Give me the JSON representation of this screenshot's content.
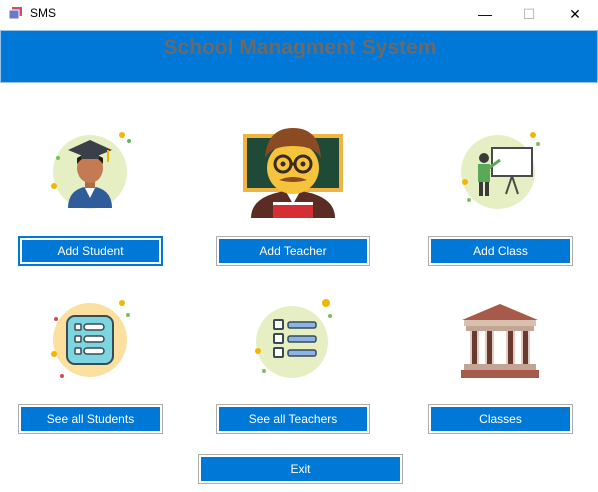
{
  "window": {
    "title": "SMS",
    "minimize_glyph": "—",
    "maximize_glyph": "☐",
    "close_glyph": "✕"
  },
  "header": {
    "title": "School Managment System"
  },
  "buttons": {
    "add_student": "Add Student",
    "add_teacher": "Add Teacher",
    "add_class": "Add Class",
    "see_students": "See all Students",
    "see_teachers": "See all Teachers",
    "classes": "Classes",
    "exit": "Exit"
  },
  "colors": {
    "accent": "#0078d7",
    "title_text": "#6a6a6a",
    "button_text": "#ffffff"
  },
  "icons": [
    "student-icon",
    "teacher-icon",
    "class-presentation-icon",
    "student-list-icon",
    "teacher-list-icon",
    "institution-building-icon"
  ]
}
